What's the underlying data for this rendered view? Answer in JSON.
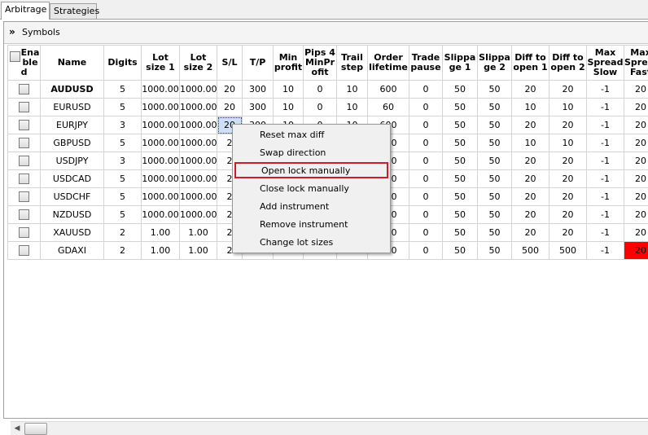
{
  "tabs": [
    {
      "label": "Arbitrage",
      "active": true
    },
    {
      "label": "Strategies",
      "active": false
    }
  ],
  "panel": {
    "title": "Symbols",
    "collapse_icon": "double-chevron-down-icon"
  },
  "grid": {
    "headers": [
      "Ena ble d",
      "Name",
      "Digits",
      "Lot size 1",
      "Lot size 2",
      "S/L",
      "T/P",
      "Min profit",
      "Pips 4 MinPr ofit",
      "Trail step",
      "Order lifetime",
      "Trade pause",
      "Slippa ge 1",
      "Slippa ge 2",
      "Diff to open 1",
      "Diff to open 2",
      "Max Spread Slow",
      "Max Spread Fast"
    ],
    "rows": [
      [
        "",
        "AUDUSD",
        "5",
        "1000.00",
        "1000.00",
        "20",
        "300",
        "10",
        "0",
        "10",
        "600",
        "0",
        "50",
        "50",
        "20",
        "20",
        "-1",
        "20"
      ],
      [
        "",
        "EURUSD",
        "5",
        "1000.00",
        "1000.00",
        "20",
        "300",
        "10",
        "0",
        "10",
        "60",
        "0",
        "50",
        "50",
        "10",
        "10",
        "-1",
        "20"
      ],
      [
        "",
        "EURJPY",
        "3",
        "1000.00",
        "1000.00",
        "20",
        "300",
        "10",
        "0",
        "10",
        "600",
        "0",
        "50",
        "50",
        "20",
        "20",
        "-1",
        "20"
      ],
      [
        "",
        "GBPUSD",
        "5",
        "1000.00",
        "1000.00",
        "2",
        "",
        "",
        "",
        "",
        "600",
        "0",
        "50",
        "50",
        "10",
        "10",
        "-1",
        "20"
      ],
      [
        "",
        "USDJPY",
        "3",
        "1000.00",
        "1000.00",
        "2",
        "",
        "",
        "",
        "",
        "600",
        "0",
        "50",
        "50",
        "20",
        "20",
        "-1",
        "20"
      ],
      [
        "",
        "USDCAD",
        "5",
        "1000.00",
        "1000.00",
        "2",
        "",
        "",
        "",
        "",
        "600",
        "0",
        "50",
        "50",
        "20",
        "20",
        "-1",
        "20"
      ],
      [
        "",
        "USDCHF",
        "5",
        "1000.00",
        "1000.00",
        "2",
        "",
        "",
        "",
        "",
        "600",
        "0",
        "50",
        "50",
        "20",
        "20",
        "-1",
        "20"
      ],
      [
        "",
        "NZDUSD",
        "5",
        "1000.00",
        "1000.00",
        "2",
        "",
        "",
        "",
        "",
        "600",
        "0",
        "50",
        "50",
        "20",
        "20",
        "-1",
        "20"
      ],
      [
        "",
        "XAUUSD",
        "2",
        "1.00",
        "1.00",
        "2",
        "",
        "",
        "",
        "",
        "600",
        "0",
        "50",
        "50",
        "20",
        "20",
        "-1",
        "20"
      ],
      [
        "",
        "GDAXI",
        "2",
        "1.00",
        "1.00",
        "2",
        "",
        "",
        "",
        "",
        "600",
        "0",
        "50",
        "50",
        "500",
        "500",
        "-1",
        "20"
      ]
    ]
  },
  "context_menu": {
    "items": [
      "Reset max diff",
      "Swap direction",
      "Open lock manually",
      "Close lock manually",
      "Add instrument",
      "Remove instrument",
      "Change  lot sizes"
    ],
    "highlighted": "Open lock manually",
    "highlight_color": "#d01c2a"
  },
  "colors": {
    "selected_cell": "#cfe0f6",
    "alert_cell": "#ff0000"
  }
}
